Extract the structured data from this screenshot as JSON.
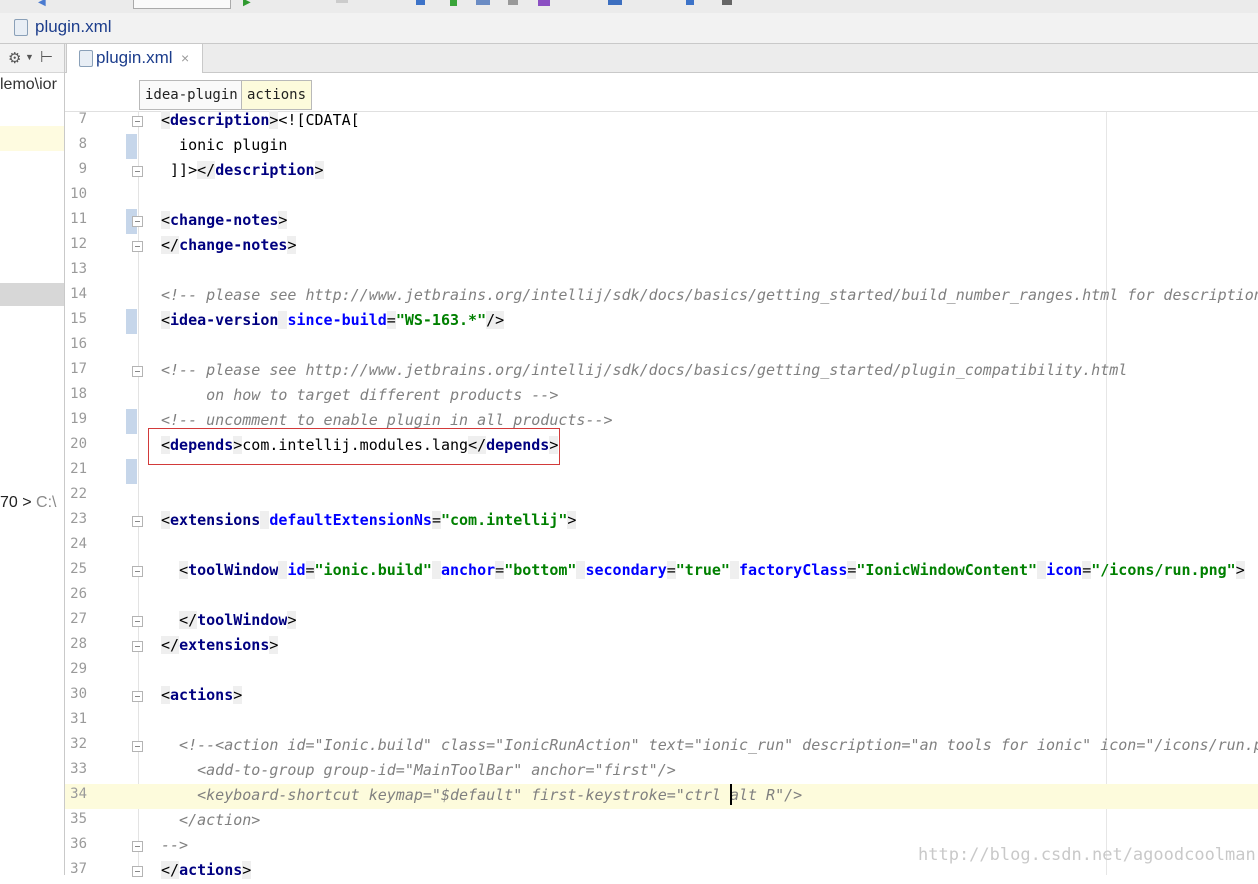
{
  "navbar": {
    "file_label": "plugin.xml"
  },
  "left_panel": {
    "path_fragment": "lemo\\ior",
    "console_prefix": "70 >",
    "console_path": "C:\\"
  },
  "tab": {
    "label": "plugin.xml",
    "close_glyph": "×"
  },
  "breadcrumbs": [
    "idea-plugin",
    "actions"
  ],
  "editor": {
    "current_line": 34,
    "lines": [
      {
        "n": "7",
        "fold": true,
        "mark": false,
        "tokens": [
          {
            "t": "<",
            "c": "tagwrap"
          },
          {
            "t": "description",
            "c": "tag"
          },
          {
            "t": ">",
            "c": "tagwrap"
          },
          {
            "t": "<![CDATA[",
            "c": "plain"
          }
        ]
      },
      {
        "n": "8",
        "fold": false,
        "mark": true,
        "tokens": [
          {
            "t": "  ionic plugin",
            "c": "plain"
          }
        ]
      },
      {
        "n": "9",
        "fold": true,
        "mark": false,
        "tokens": [
          {
            "t": " ]]>",
            "c": "plain"
          },
          {
            "t": "</",
            "c": "tagwrap"
          },
          {
            "t": "description",
            "c": "tag"
          },
          {
            "t": ">",
            "c": "tagwrap"
          }
        ]
      },
      {
        "n": "10",
        "fold": false,
        "mark": false,
        "tokens": []
      },
      {
        "n": "11",
        "fold": true,
        "mark": true,
        "tokens": [
          {
            "t": "<",
            "c": "tagwrap"
          },
          {
            "t": "change-notes",
            "c": "tag"
          },
          {
            "t": ">",
            "c": "tagwrap"
          }
        ]
      },
      {
        "n": "12",
        "fold": true,
        "mark": false,
        "tokens": [
          {
            "t": "</",
            "c": "tagwrap"
          },
          {
            "t": "change-notes",
            "c": "tag"
          },
          {
            "t": ">",
            "c": "tagwrap"
          }
        ]
      },
      {
        "n": "13",
        "fold": false,
        "mark": false,
        "tokens": []
      },
      {
        "n": "14",
        "fold": false,
        "mark": false,
        "tokens": [
          {
            "t": "<!-- please see http://www.jetbrains.org/intellij/sdk/docs/basics/getting_started/build_number_ranges.html for description -->",
            "c": "cmt"
          }
        ]
      },
      {
        "n": "15",
        "fold": false,
        "mark": true,
        "tokens": [
          {
            "t": "<",
            "c": "tagwrap"
          },
          {
            "t": "idea-version",
            "c": "tag"
          },
          {
            "t": " ",
            "c": "tagwrap"
          },
          {
            "t": "since-build",
            "c": "attr"
          },
          {
            "t": "=",
            "c": "tagwrap"
          },
          {
            "t": "\"WS-163.*\"",
            "c": "val"
          },
          {
            "t": "/>",
            "c": "tagwrap"
          }
        ]
      },
      {
        "n": "16",
        "fold": false,
        "mark": false,
        "tokens": []
      },
      {
        "n": "17",
        "fold": true,
        "mark": false,
        "tokens": [
          {
            "t": "<!-- please see http://www.jetbrains.org/intellij/sdk/docs/basics/getting_started/plugin_compatibility.html",
            "c": "cmt"
          }
        ]
      },
      {
        "n": "18",
        "fold": false,
        "mark": false,
        "tokens": [
          {
            "t": "     on how to target different products -->",
            "c": "cmt"
          }
        ]
      },
      {
        "n": "19",
        "fold": false,
        "mark": true,
        "tokens": [
          {
            "t": "<!-- uncomment to enable plugin in all products-->",
            "c": "cmt"
          }
        ]
      },
      {
        "n": "20",
        "fold": false,
        "mark": false,
        "tokens": [
          {
            "t": "<",
            "c": "tagwrap"
          },
          {
            "t": "depends",
            "c": "tag"
          },
          {
            "t": ">",
            "c": "tagwrap"
          },
          {
            "t": "com.intellij.modules.lang",
            "c": "plain"
          },
          {
            "t": "</",
            "c": "tagwrap"
          },
          {
            "t": "depends",
            "c": "tag"
          },
          {
            "t": ">",
            "c": "tagwrap"
          }
        ]
      },
      {
        "n": "21",
        "fold": false,
        "mark": true,
        "tokens": []
      },
      {
        "n": "22",
        "fold": false,
        "mark": false,
        "tokens": []
      },
      {
        "n": "23",
        "fold": true,
        "mark": false,
        "tokens": [
          {
            "t": "<",
            "c": "tagwrap"
          },
          {
            "t": "extensions",
            "c": "tag"
          },
          {
            "t": " ",
            "c": "tagwrap"
          },
          {
            "t": "defaultExtensionNs",
            "c": "attr"
          },
          {
            "t": "=",
            "c": "tagwrap"
          },
          {
            "t": "\"com.intellij\"",
            "c": "val"
          },
          {
            "t": ">",
            "c": "tagwrap"
          }
        ]
      },
      {
        "n": "24",
        "fold": false,
        "mark": false,
        "tokens": []
      },
      {
        "n": "25",
        "fold": true,
        "mark": false,
        "tokens": [
          {
            "t": "  ",
            "c": "plain"
          },
          {
            "t": "<",
            "c": "tagwrap"
          },
          {
            "t": "toolWindow",
            "c": "tag"
          },
          {
            "t": " ",
            "c": "tagwrap"
          },
          {
            "t": "id",
            "c": "attr"
          },
          {
            "t": "=",
            "c": "tagwrap"
          },
          {
            "t": "\"ionic.build\"",
            "c": "val"
          },
          {
            "t": " ",
            "c": "tagwrap"
          },
          {
            "t": "anchor",
            "c": "attr"
          },
          {
            "t": "=",
            "c": "tagwrap"
          },
          {
            "t": "\"bottom\"",
            "c": "val"
          },
          {
            "t": " ",
            "c": "tagwrap"
          },
          {
            "t": "secondary",
            "c": "attr"
          },
          {
            "t": "=",
            "c": "tagwrap"
          },
          {
            "t": "\"true\"",
            "c": "val"
          },
          {
            "t": " ",
            "c": "tagwrap"
          },
          {
            "t": "factoryClass",
            "c": "attr"
          },
          {
            "t": "=",
            "c": "tagwrap"
          },
          {
            "t": "\"IonicWindowContent\"",
            "c": "val"
          },
          {
            "t": " ",
            "c": "tagwrap"
          },
          {
            "t": "icon",
            "c": "attr"
          },
          {
            "t": "=",
            "c": "tagwrap"
          },
          {
            "t": "\"/icons/run.png\"",
            "c": "val"
          },
          {
            "t": ">",
            "c": "tagwrap"
          }
        ]
      },
      {
        "n": "26",
        "fold": false,
        "mark": false,
        "tokens": []
      },
      {
        "n": "27",
        "fold": true,
        "mark": false,
        "tokens": [
          {
            "t": "  ",
            "c": "plain"
          },
          {
            "t": "</",
            "c": "tagwrap"
          },
          {
            "t": "toolWindow",
            "c": "tag"
          },
          {
            "t": ">",
            "c": "tagwrap"
          }
        ]
      },
      {
        "n": "28",
        "fold": true,
        "mark": false,
        "tokens": [
          {
            "t": "</",
            "c": "tagwrap"
          },
          {
            "t": "extensions",
            "c": "tag"
          },
          {
            "t": ">",
            "c": "tagwrap"
          }
        ]
      },
      {
        "n": "29",
        "fold": false,
        "mark": false,
        "tokens": []
      },
      {
        "n": "30",
        "fold": true,
        "mark": false,
        "tokens": [
          {
            "t": "<",
            "c": "tagwrap"
          },
          {
            "t": "actions",
            "c": "tag"
          },
          {
            "t": ">",
            "c": "tagwrap"
          }
        ]
      },
      {
        "n": "31",
        "fold": false,
        "mark": false,
        "tokens": []
      },
      {
        "n": "32",
        "fold": true,
        "mark": false,
        "tokens": [
          {
            "t": "  <!--<action id=\"Ionic.build\" class=\"IonicRunAction\" text=\"ionic_run\" description=\"an tools for ionic\" icon=\"/icons/run.png\">",
            "c": "cmt"
          }
        ]
      },
      {
        "n": "33",
        "fold": false,
        "mark": false,
        "tokens": [
          {
            "t": "    <add-to-group group-id=\"MainToolBar\" anchor=\"first\"/>",
            "c": "cmt"
          }
        ]
      },
      {
        "n": "34",
        "fold": false,
        "mark": false,
        "tokens": [
          {
            "t": "    <keyboard-shortcut keymap=\"$default\" first-keystroke=\"ctrl alt R\"/>",
            "c": "cmt"
          }
        ]
      },
      {
        "n": "35",
        "fold": false,
        "mark": false,
        "tokens": [
          {
            "t": "  </action>",
            "c": "cmt"
          }
        ]
      },
      {
        "n": "36",
        "fold": true,
        "mark": false,
        "tokens": [
          {
            "t": "-->",
            "c": "cmt"
          }
        ]
      },
      {
        "n": "37",
        "fold": true,
        "mark": false,
        "tokens": [
          {
            "t": "</",
            "c": "tagwrap"
          },
          {
            "t": "actions",
            "c": "tag"
          },
          {
            "t": ">",
            "c": "tagwrap"
          }
        ]
      }
    ]
  },
  "watermark": "http://blog.csdn.net/agoodcoolman"
}
